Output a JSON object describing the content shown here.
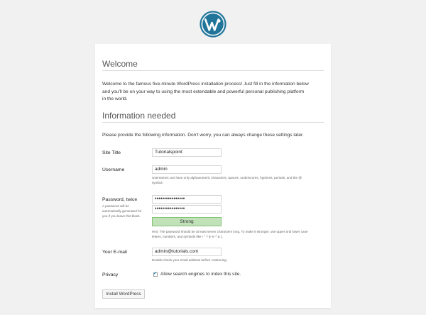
{
  "welcome": {
    "title": "Welcome",
    "text_line1": "Welcome to the famous five-minute WordPress installation process! Just fill in the information below",
    "text_line2": "and you'll be on your way to using the most extendable and powerful personal publishing platform",
    "text_line3": "in the world."
  },
  "info": {
    "title": "Information needed",
    "intro": "Please provide the following information. Don't worry, you can always change these settings later."
  },
  "fields": {
    "site_title": {
      "label": "Site Title",
      "value": "Tutorialspoint"
    },
    "username": {
      "label": "Username",
      "value": "admin",
      "help_line1": "Usernames can have only alphanumeric characters, spaces, underscores, hyphens, periods, and the @",
      "help_line2": "symbol."
    },
    "password": {
      "label": "Password, twice",
      "value1": "••••••••••••••••",
      "value2": "••••••••••••••••",
      "side_note_line1": "A password will be",
      "side_note_line2": "automatically generated for",
      "side_note_line3": "you if you leave this blank.",
      "strength": "Strong",
      "hint_line1": "Hint: The password should be at least seven characters long. To make it stronger, use upper and lower case",
      "hint_line2": "letters, numbers, and symbols like ! \" ? $ % ^ & )."
    },
    "email": {
      "label": "Your E-mail",
      "value": "admin@tutorials.com",
      "help": "Double-check your email address before continuing."
    },
    "privacy": {
      "label": "Privacy",
      "checkbox_label": "Allow search engines to index this site.",
      "checked": true
    }
  },
  "install_button": "Install WordPress",
  "colors": {
    "brand": "#21759b",
    "strength_bg": "#c1e1b9",
    "page_bg": "#f1f1f1"
  },
  "icons": {
    "logo": "wordpress-logo-icon",
    "check": "checkmark-icon"
  }
}
